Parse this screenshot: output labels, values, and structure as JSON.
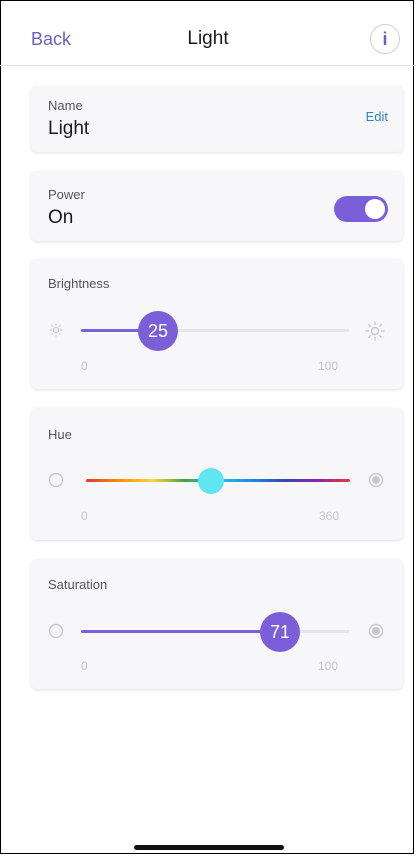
{
  "nav": {
    "back": "Back",
    "title": "Light",
    "info_icon": "i"
  },
  "name_card": {
    "label": "Name",
    "value": "Light",
    "edit": "Edit"
  },
  "power_card": {
    "label": "Power",
    "value": "On",
    "toggle_on": true
  },
  "brightness": {
    "label": "Brightness",
    "value": "25",
    "min": "0",
    "max": "100",
    "icon_min": "sun-small-icon",
    "icon_max": "sun-large-icon"
  },
  "hue": {
    "label": "Hue",
    "value": 200,
    "min": "0",
    "max": "360",
    "thumb_color": "#5fe6f2"
  },
  "saturation": {
    "label": "Saturation",
    "value": "71",
    "min": "0",
    "max": "100"
  },
  "colors": {
    "accent": "#7b5fd8",
    "link": "#2e86c9"
  }
}
